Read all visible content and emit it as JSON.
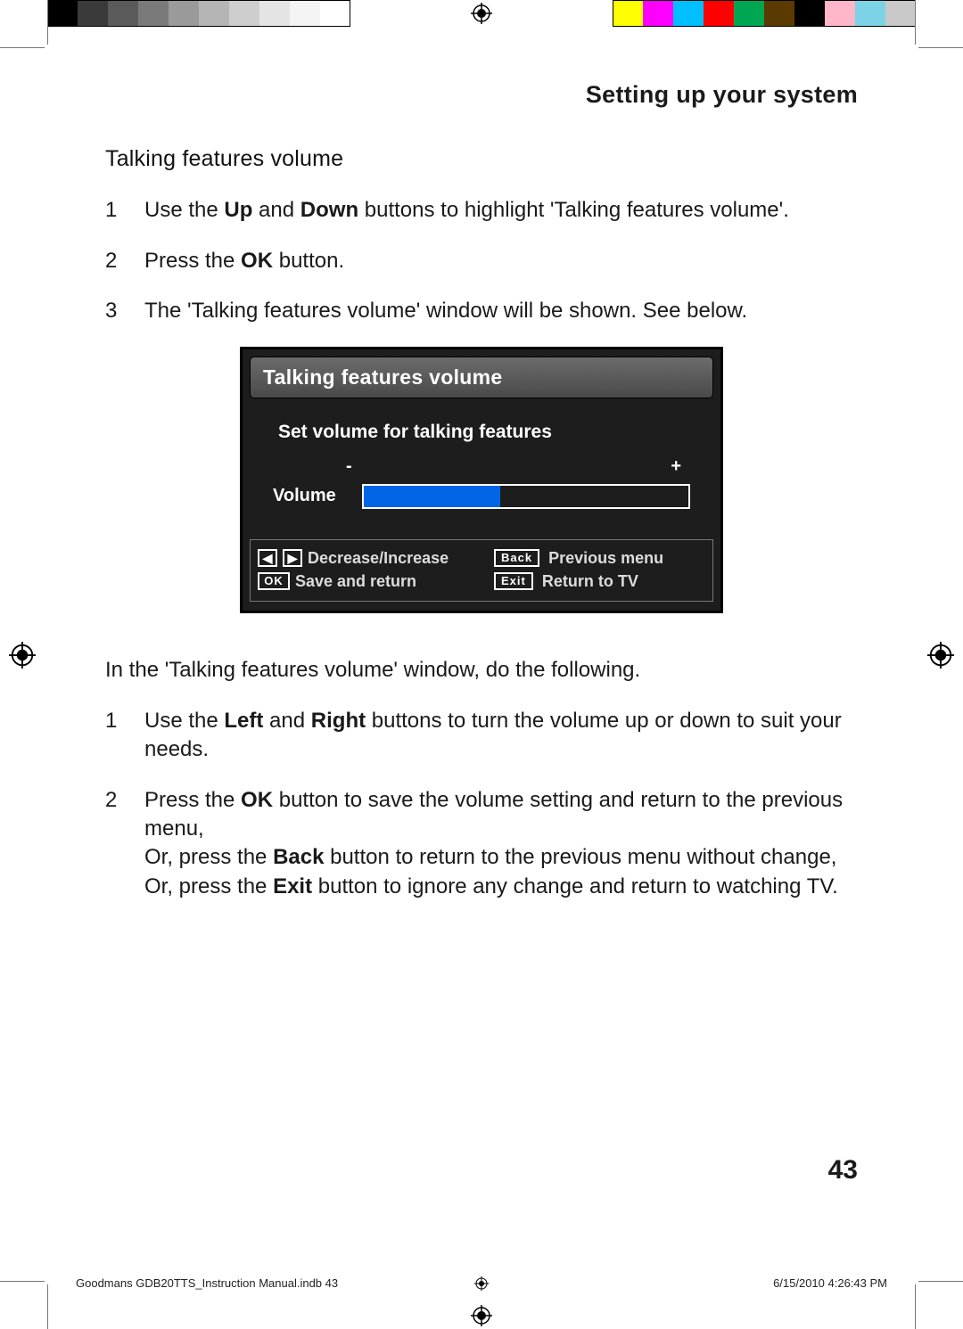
{
  "colorbars": {
    "left": [
      "#000000",
      "#3a3a3a",
      "#5a5a5a",
      "#7a7a7a",
      "#9a9a9a",
      "#b5b5b5",
      "#cecece",
      "#e4e4e4",
      "#f4f4f4",
      "#ffffff"
    ],
    "right": [
      "#ffff00",
      "#ff00ff",
      "#00bfff",
      "#ff0000",
      "#00a651",
      "#5a3a00",
      "#000000",
      "#ffb6c8",
      "#7dd3e6",
      "#c9c9c9"
    ]
  },
  "header": "Setting up your system",
  "subheading": "Talking features volume",
  "steps1": [
    {
      "n": "1",
      "pre": "Use the ",
      "b1": "Up",
      "mid": " and ",
      "b2": "Down",
      "post": " buttons to highlight 'Talking features volume'."
    },
    {
      "n": "2",
      "pre": "Press the ",
      "b1": "OK",
      "mid": "",
      "b2": "",
      "post": " button."
    },
    {
      "n": "3",
      "pre": "The 'Talking features volume' window will be shown. See below.",
      "b1": "",
      "mid": "",
      "b2": "",
      "post": ""
    }
  ],
  "osd": {
    "title": "Talking features volume",
    "sub": "Set volume for talking features",
    "minus": "-",
    "plus": "+",
    "volume_label": "Volume",
    "footer": {
      "arrows_label": "Decrease/Increase",
      "back_key": "Back",
      "back_label": "Previous menu",
      "ok_key": "OK",
      "ok_label": "Save and return",
      "exit_key": "Exit",
      "exit_label": "Return to TV"
    }
  },
  "intro2": "In the 'Talking features volume' window, do the following.",
  "steps2": [
    {
      "n": "1",
      "pre": "Use the ",
      "b1": "Left",
      "mid": " and ",
      "b2": "Right",
      "post": " buttons to turn the volume up or down to suit your needs."
    },
    {
      "n": "2",
      "pre": "Press the ",
      "b1": "OK",
      "mid": " button to save the volume setting and return to the previous menu,\nOr, press the ",
      "b2": "Back",
      "post": " button to return to the previous menu without change,\nOr, press the ",
      "b3": "Exit",
      "post2": " button to ignore any change and return to watching TV."
    }
  ],
  "page_number": "43",
  "footer": {
    "left": "Goodmans GDB20TTS_Instruction Manual.indb   43",
    "right": "6/15/2010   4:26:43 PM"
  }
}
